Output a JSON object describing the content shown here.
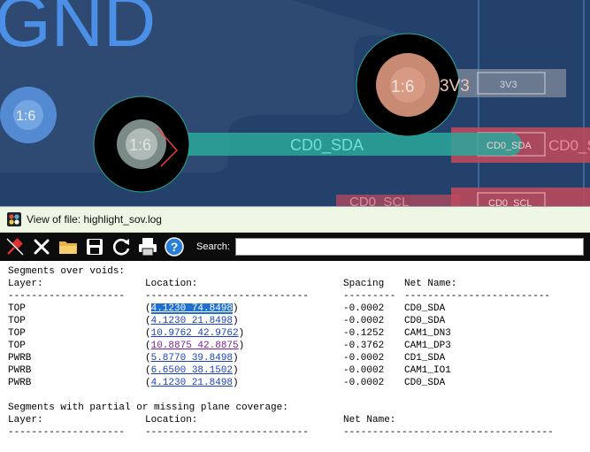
{
  "pcb": {
    "gnd_label": "GND",
    "pad_labels": [
      "1:6",
      "1:6",
      "1:6"
    ],
    "trace_cd0_sda": "CD0_SDA",
    "net_3v3": "3V3",
    "net_3v3_box": "3V3",
    "cd0_sda_box": "CD0_SDA",
    "cd0_sda_right": "CD0_S",
    "cd0_scl": "CD0_SCL",
    "cd0_scl_box": "CD0_SCL"
  },
  "window": {
    "title": "View of file: highlight_sov.log",
    "search_label": "Search:",
    "search_value": ""
  },
  "toolbar": {
    "buttons": [
      "pin-icon",
      "close-icon",
      "folder-open-icon",
      "save-icon",
      "refresh-icon",
      "print-icon",
      "help-icon"
    ]
  },
  "log": {
    "section1_title": "Segments over voids:",
    "section1_headers": {
      "layer": "Layer:",
      "location": "Location:",
      "spacing": "Spacing",
      "net": "Net Name:"
    },
    "section1_sep": {
      "layer": "--------------------",
      "location": "----------------------------",
      "spacing": "---------",
      "net": "-------------------------"
    },
    "rows": [
      {
        "layer": "TOP",
        "location": "4.1230 74.8498",
        "spacing": "-0.0002",
        "net": "CD0_SDA"
      },
      {
        "layer": "TOP",
        "location": "4.1230 21.8498",
        "spacing": "-0.0002",
        "net": "CD0_SDA"
      },
      {
        "layer": "TOP",
        "location": "10.9762 42.9762",
        "spacing": "-0.1252",
        "net": "CAM1_DN3"
      },
      {
        "layer": "TOP",
        "location": "10.8875 42.8875",
        "spacing": "-0.3762",
        "net": "CAM1_DP3"
      },
      {
        "layer": "PWRB",
        "location": "5.8770 39.8498",
        "spacing": "-0.0002",
        "net": "CD1_SDA"
      },
      {
        "layer": "PWRB",
        "location": "6.6500 38.1502",
        "spacing": "-0.0002",
        "net": "CAM1_IO1"
      },
      {
        "layer": "PWRB",
        "location": "4.1230 21.8498",
        "spacing": "-0.0002",
        "net": "CD0_SDA"
      }
    ],
    "section2_title": "Segments with partial or missing plane coverage:",
    "section2_headers": {
      "layer": "Layer:",
      "location": "Location:",
      "net": "Net Name:"
    },
    "section2_sep": {
      "layer": "--------------------",
      "location": "----------------------------",
      "net": "------------------------------------"
    }
  }
}
